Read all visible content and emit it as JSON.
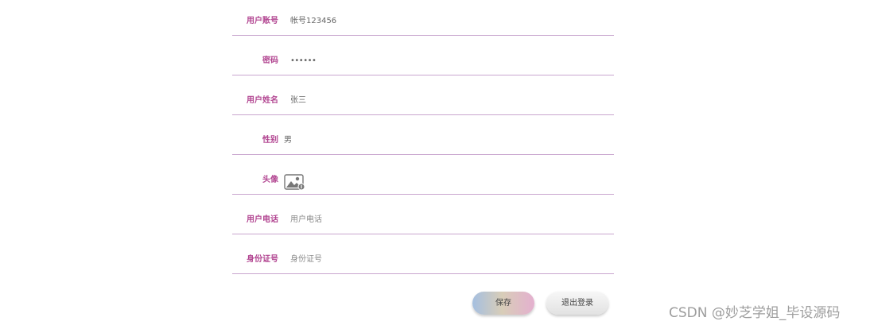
{
  "form": {
    "account": {
      "label": "用户账号",
      "value": "帐号123456"
    },
    "password": {
      "label": "密码",
      "value": "••••••"
    },
    "name": {
      "label": "用户姓名",
      "value": "张三"
    },
    "sex": {
      "label": "性别",
      "value": "男"
    },
    "avatar": {
      "label": "头像",
      "icon": "image-upload-icon"
    },
    "phone": {
      "label": "用户电话",
      "placeholder": "用户电话"
    },
    "id_card": {
      "label": "身份证号",
      "placeholder": "身份证号"
    }
  },
  "buttons": {
    "save": "保存",
    "logout": "退出登录"
  },
  "watermark": "CSDN @妙芝学姐_毕设源码",
  "colors": {
    "label": "#b24591",
    "underline": "#c9a6cf",
    "save_gradient_start": "#a5bfe0",
    "save_gradient_end": "#e4b0cf"
  }
}
